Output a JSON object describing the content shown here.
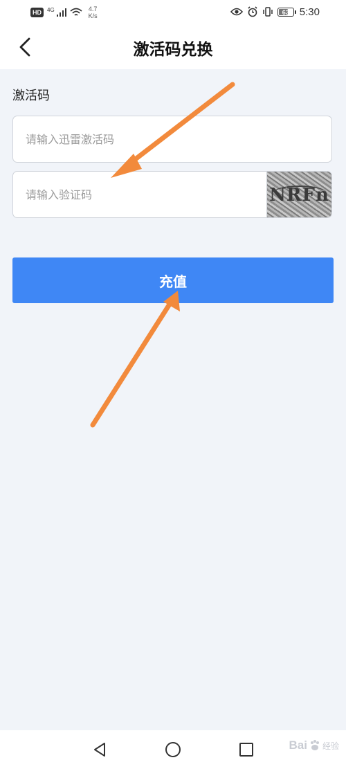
{
  "status_bar": {
    "hd": "HD",
    "network": "4G",
    "speed_value": "4.7",
    "speed_unit": "K/s",
    "battery": "63",
    "time": "5:30"
  },
  "header": {
    "title": "激活码兑换"
  },
  "form": {
    "section_label": "激活码",
    "activation_placeholder": "请输入迅雷激活码",
    "captcha_placeholder": "请输入验证码",
    "captcha_text": "NRFn",
    "submit_label": "充值"
  },
  "annotations": {
    "arrow_color": "#f28a3c"
  },
  "watermark": {
    "brand": "Bai",
    "sub": "经验"
  },
  "colors": {
    "accent": "#3f87f5",
    "background": "#f1f4f9"
  }
}
